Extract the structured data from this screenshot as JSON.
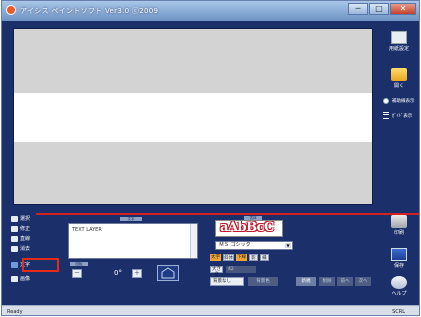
{
  "window": {
    "title": "アイシス ペイントソフト Ver3.0 ⓒ2009",
    "minimize": "─",
    "maximize": "□",
    "close": "✕"
  },
  "right_toolbar": {
    "top": [
      {
        "icon": "page-settings-icon",
        "label": "用紙設定"
      },
      {
        "icon": "open-folder-icon",
        "label": "開く"
      }
    ],
    "toggles": [
      {
        "icon": "radio-icon",
        "label": "補助線表示"
      },
      {
        "icon": "guide-icon",
        "label": "ｶﾞｲﾄﾞ表示"
      }
    ],
    "bottom": [
      {
        "icon": "print-icon",
        "label": "印刷"
      },
      {
        "icon": "save-icon",
        "label": "保存"
      },
      {
        "icon": "help-icon",
        "label": "ヘルプ"
      }
    ]
  },
  "left_tools": [
    {
      "icon": "select-icon",
      "label": "選択"
    },
    {
      "icon": "edit-icon",
      "label": "修正"
    },
    {
      "icon": "line-icon",
      "label": "直線"
    },
    {
      "icon": "erase-icon",
      "label": "消去"
    },
    {
      "icon": "text-tool-icon",
      "label": "文字"
    },
    {
      "icon": "image-icon",
      "label": "画像"
    }
  ],
  "text_panel": {
    "tab": "文字",
    "value": "TEXT LAYER"
  },
  "rotation": {
    "tab": "回転",
    "minus": "－",
    "value": "0°",
    "plus": "＋"
  },
  "font_panel": {
    "tab": "書体",
    "preview": "aAbBcC",
    "font": "ＭＳ ゴシック",
    "styles": [
      "太字",
      "斜体",
      "下線",
      "影",
      "縁"
    ],
    "size_label": "大きさ",
    "size_value": "42",
    "background": "背景なし",
    "background_btn": "背景色"
  },
  "action_buttons": [
    "新規",
    "削除",
    "前へ",
    "次へ"
  ],
  "statusbar": {
    "left": "Ready",
    "right": "SCRL"
  }
}
